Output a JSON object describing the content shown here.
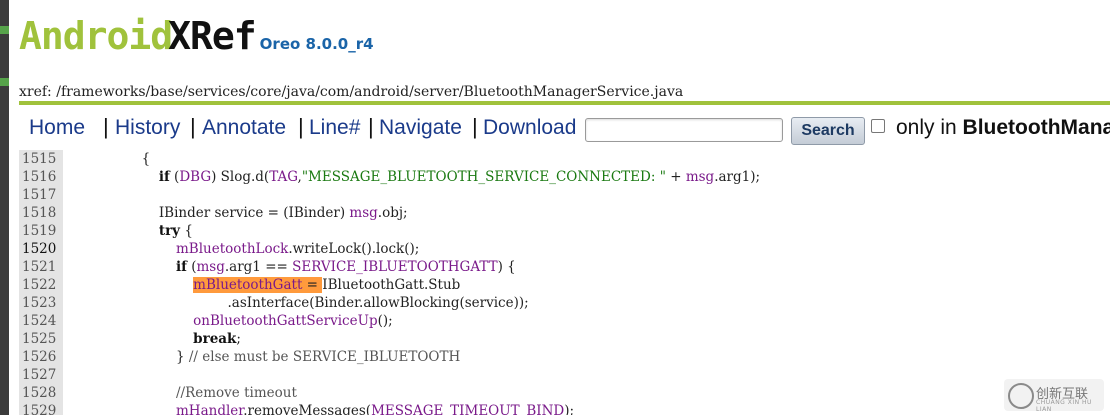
{
  "logo": {
    "part1": "Android",
    "part2": "XRef",
    "version": "Oreo 8.0.0_r4"
  },
  "xref": {
    "prefix": "xref: ",
    "path": "/frameworks/base/services/core/java/com/android/server/BluetoothManagerService.java"
  },
  "menu": {
    "items": [
      "Home",
      "History",
      "Annotate",
      "Line#",
      "Navigate",
      "Download"
    ],
    "separator": "|",
    "search_button": "Search",
    "only_in_text": "only in ",
    "only_in_file": "BluetoothMana"
  },
  "code": {
    "current_line": "1520",
    "lines": [
      {
        "n": "1515",
        "t": "                {"
      },
      {
        "n": "1516",
        "t": "                    if (DBG) Slog.d(TAG,\"MESSAGE_BLUETOOTH_SERVICE_CONNECTED: \" + msg.arg1);"
      },
      {
        "n": "1517",
        "t": ""
      },
      {
        "n": "1518",
        "t": "                    IBinder service = (IBinder) msg.obj;"
      },
      {
        "n": "1519",
        "t": "                    try {"
      },
      {
        "n": "1520",
        "t": "                        mBluetoothLock.writeLock().lock();"
      },
      {
        "n": "1521",
        "t": "                        if (msg.arg1 == SERVICE_IBLUETOOTHGATT) {"
      },
      {
        "n": "1522",
        "t": "                            mBluetoothGatt = IBluetoothGatt.Stub"
      },
      {
        "n": "1523",
        "t": "                                    .asInterface(Binder.allowBlocking(service));"
      },
      {
        "n": "1524",
        "t": "                            onBluetoothGattServiceUp();"
      },
      {
        "n": "1525",
        "t": "                            break;"
      },
      {
        "n": "1526",
        "t": "                        } // else must be SERVICE_IBLUETOOTH"
      },
      {
        "n": "1527",
        "t": ""
      },
      {
        "n": "1528",
        "t": "                        //Remove timeout"
      },
      {
        "n": "1529",
        "t": "                        mHandler.removeMessages(MESSAGE_TIMEOUT_BIND);"
      }
    ]
  },
  "colors": {
    "green": "#a0c23c",
    "highlight": "#ff9a3c",
    "link": "#1a3a8a"
  },
  "watermark": {
    "title": "创新互联",
    "sub": "CHUANG XIN HU LIAN"
  }
}
